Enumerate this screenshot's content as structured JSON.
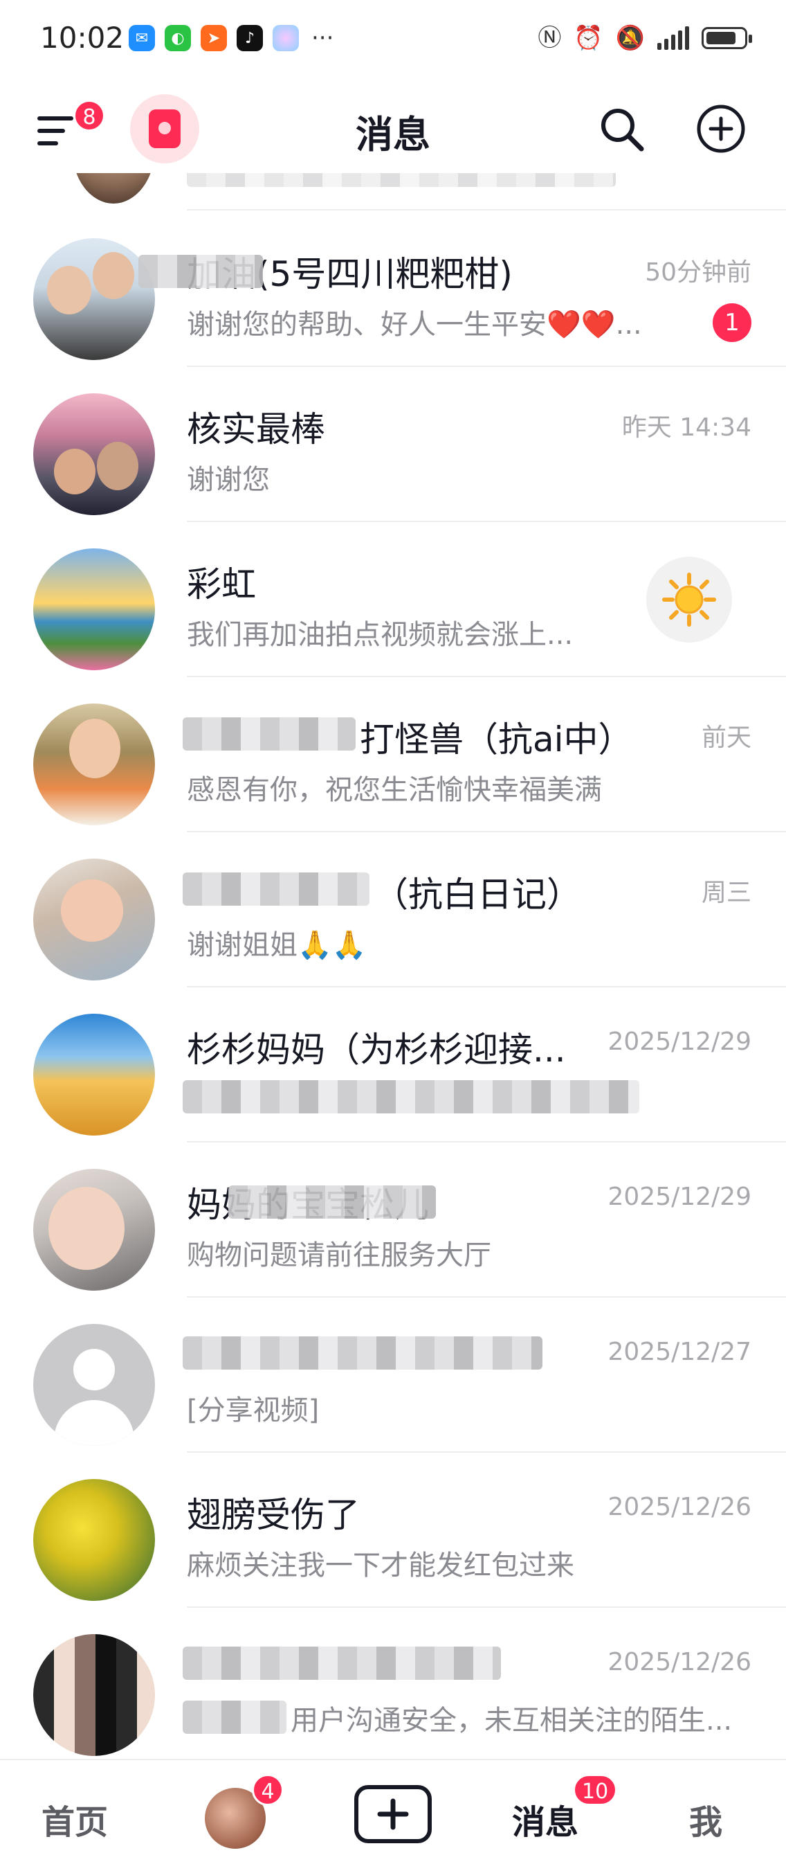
{
  "status_bar": {
    "time": "10:02",
    "more": "···"
  },
  "header": {
    "title": "消息",
    "menu_badge": "8"
  },
  "conversations": [
    {
      "name": "加油(5号四川粑粑柑)",
      "message": "谢谢您的帮助、好人一生平安❤️❤️...",
      "time": "50分钟前",
      "unread": "1"
    },
    {
      "name": "核实最棒",
      "message": "谢谢您",
      "time": "昨天 14:34"
    },
    {
      "name": "彩虹",
      "message": "我们再加油拍点视频就会涨上..."
    },
    {
      "name": "打怪兽（抗ai中）",
      "message": "感恩有你，祝您生活愉快幸福美满",
      "time": "前天"
    },
    {
      "name": "（抗白日记）",
      "message": "谢谢姐姐🙏🙏",
      "time": "周三"
    },
    {
      "name": "杉杉妈妈（为杉杉迎接...",
      "message": "",
      "time": "2025/12/29"
    },
    {
      "name": "妈妈的宝宝松儿",
      "message": "购物问题请前往服务大厅",
      "time": "2025/12/29"
    },
    {
      "name": "",
      "message": "[分享视频]",
      "time": "2025/12/27"
    },
    {
      "name": "翅膀受伤了",
      "message": "麻烦关注我一下才能发红包过来",
      "time": "2025/12/26"
    },
    {
      "name": "",
      "message": "用户沟通安全，未互相关注的陌生...",
      "time": "2025/12/26"
    }
  ],
  "tabbar": {
    "home": "首页",
    "friends_badge": "4",
    "messages": "消息",
    "messages_badge": "10",
    "me": "我"
  },
  "colors": {
    "accent": "#fe2c55",
    "text_primary": "#161823",
    "text_secondary": "#8a8b91",
    "time_text": "#a8a9ad"
  }
}
